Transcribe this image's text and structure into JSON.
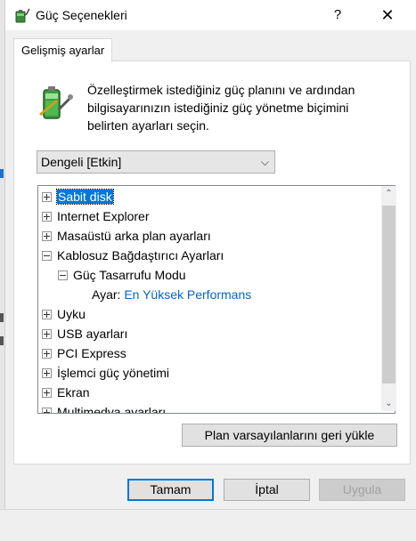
{
  "window": {
    "title": "Güç Seçenekleri",
    "help_glyph": "?",
    "close_glyph": "✕"
  },
  "tab": {
    "label": "Gelişmiş ayarlar"
  },
  "description": "Özelleştirmek istediğiniz güç planını ve ardından bilgisayarınızın istediğiniz güç yönetme biçimini belirten ayarları seçin.",
  "plan_select": {
    "value": "Dengeli [Etkin]",
    "arrow": "⌵"
  },
  "tree": {
    "items": [
      {
        "label": "Sabit disk",
        "expanded": false,
        "selected": true
      },
      {
        "label": "Internet Explorer",
        "expanded": false
      },
      {
        "label": "Masaüstü arka plan ayarları",
        "expanded": false
      },
      {
        "label": "Kablosuz Bağdaştırıcı Ayarları",
        "expanded": true
      },
      {
        "label": "Güç Tasarrufu Modu",
        "expanded": true,
        "level": 1
      },
      {
        "setting_label": "Ayar:",
        "setting_value": "En Yüksek Performans",
        "level": 2
      },
      {
        "label": "Uyku",
        "expanded": false
      },
      {
        "label": "USB ayarları",
        "expanded": false
      },
      {
        "label": "PCI Express",
        "expanded": false
      },
      {
        "label": "İşlemci güç yönetimi",
        "expanded": false
      },
      {
        "label": "Ekran",
        "expanded": false
      },
      {
        "label": "Multimedya ayarları",
        "expanded": false
      }
    ],
    "scroll_up": "⌃",
    "scroll_down": "⌄"
  },
  "restore_button": "Plan varsayılanlarını geri yükle",
  "buttons": {
    "ok": "Tamam",
    "cancel": "İptal",
    "apply": "Uygula"
  },
  "colors": {
    "accent": "#0078d7",
    "link": "#0066cc"
  }
}
